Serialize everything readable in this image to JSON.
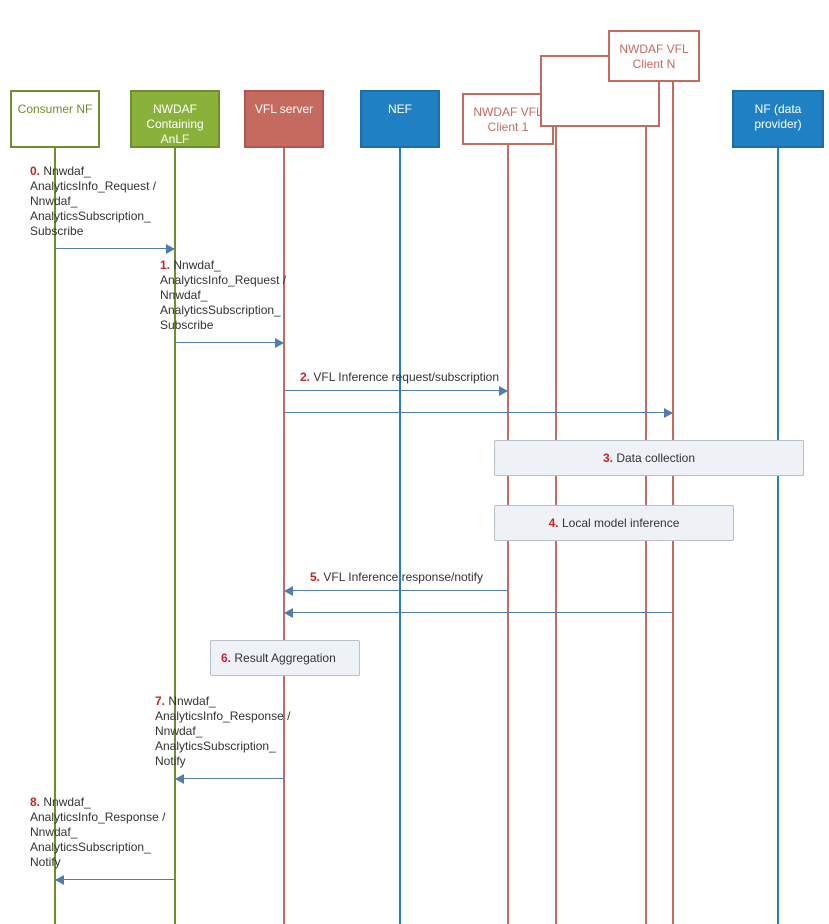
{
  "participants": {
    "consumer": {
      "label": "Consumer NF"
    },
    "anlf": {
      "label": "NWDAF\nContaining\nAnLF"
    },
    "vflserver": {
      "label": "VFL server"
    },
    "nef": {
      "label": "NEF"
    },
    "client1": {
      "label": "NWDAF VFL\nClient 1"
    },
    "clientN": {
      "label": "NWDAF VFL\nClient N"
    },
    "nf": {
      "label": "NF\n(data provider)"
    }
  },
  "messages": {
    "m0": {
      "num": "0.",
      "text": "Nnwdaf_\nAnalyticsInfo_Request /\nNnwdaf_\nAnalyticsSubscription_\nSubscribe"
    },
    "m1": {
      "num": "1.",
      "text": "Nnwdaf_\nAnalyticsInfo_Request /\nNnwdaf_\nAnalyticsSubscription_\nSubscribe"
    },
    "m2": {
      "num": "2.",
      "text": "VFL Inference request/subscription"
    },
    "m3": {
      "num": "3.",
      "text": "Data collection"
    },
    "m4": {
      "num": "4.",
      "text": "Local model inference"
    },
    "m5": {
      "num": "5.",
      "text": "VFL Inference response/notify"
    },
    "m6": {
      "num": "6.",
      "text": "Result Aggregation"
    },
    "m7": {
      "num": "7.",
      "text": "Nnwdaf_\nAnalyticsInfo_Response /\nNnwdaf_\nAnalyticsSubscription_\nNotify"
    },
    "m8": {
      "num": "8.",
      "text": "Nnwdaf_\nAnalyticsInfo_Response /\nNnwdaf_\nAnalyticsSubscription_\nNotify"
    }
  }
}
